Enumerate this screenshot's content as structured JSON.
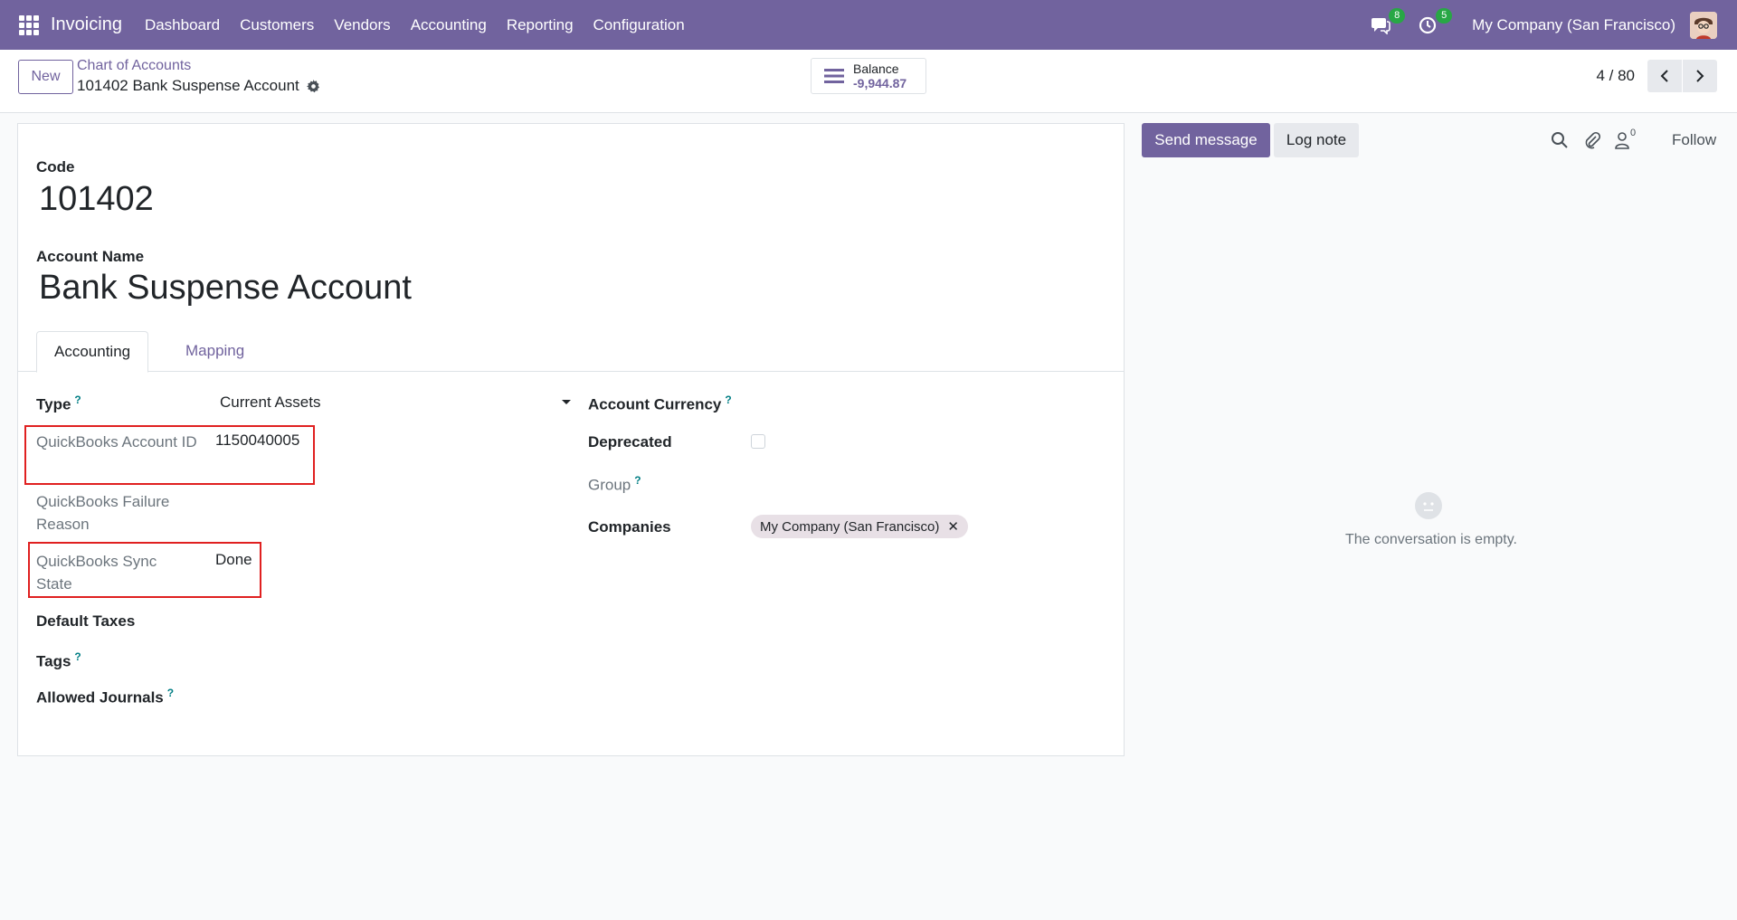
{
  "topbar": {
    "app_name": "Invoicing",
    "menu": [
      "Dashboard",
      "Customers",
      "Vendors",
      "Accounting",
      "Reporting",
      "Configuration"
    ],
    "messages_count": "8",
    "activities_count": "5",
    "company": "My Company (San Francisco)"
  },
  "control": {
    "new_label": "New",
    "breadcrumb_parent": "Chart of Accounts",
    "breadcrumb_current": "101402 Bank Suspense Account",
    "balance_label": "Balance",
    "balance_value": "-9,944.87",
    "pager": "4 / 80"
  },
  "form": {
    "code_label": "Code",
    "code_value": "101402",
    "name_label": "Account Name",
    "name_value": "Bank Suspense Account",
    "tabs": [
      "Accounting",
      "Mapping"
    ],
    "type_label": "Type",
    "type_help": "?",
    "type_value": "Current Assets",
    "qb_id_label": "QuickBooks Account ID",
    "qb_id_value": "1150040005",
    "qb_failure_label": "QuickBooks Failure Reason",
    "qb_sync_label": "QuickBooks Sync State",
    "qb_sync_value": "Done",
    "default_taxes_label": "Default Taxes",
    "tags_label": "Tags",
    "tags_help": "?",
    "journals_label": "Allowed Journals",
    "journals_help": "?",
    "currency_label": "Account Currency",
    "currency_help": "?",
    "deprecated_label": "Deprecated",
    "group_label": "Group",
    "group_help": "?",
    "companies_label": "Companies",
    "companies_tag": "My Company (San Francisco)",
    "tag_remove": "✕"
  },
  "chatter": {
    "send_label": "Send message",
    "log_label": "Log note",
    "followers_count": "0",
    "follow_label": "Follow",
    "empty_text": "The conversation is empty."
  },
  "colors": {
    "brand": "#71639e",
    "badge": "#28a745",
    "highlight": "#e02020",
    "help": "#017e84"
  }
}
